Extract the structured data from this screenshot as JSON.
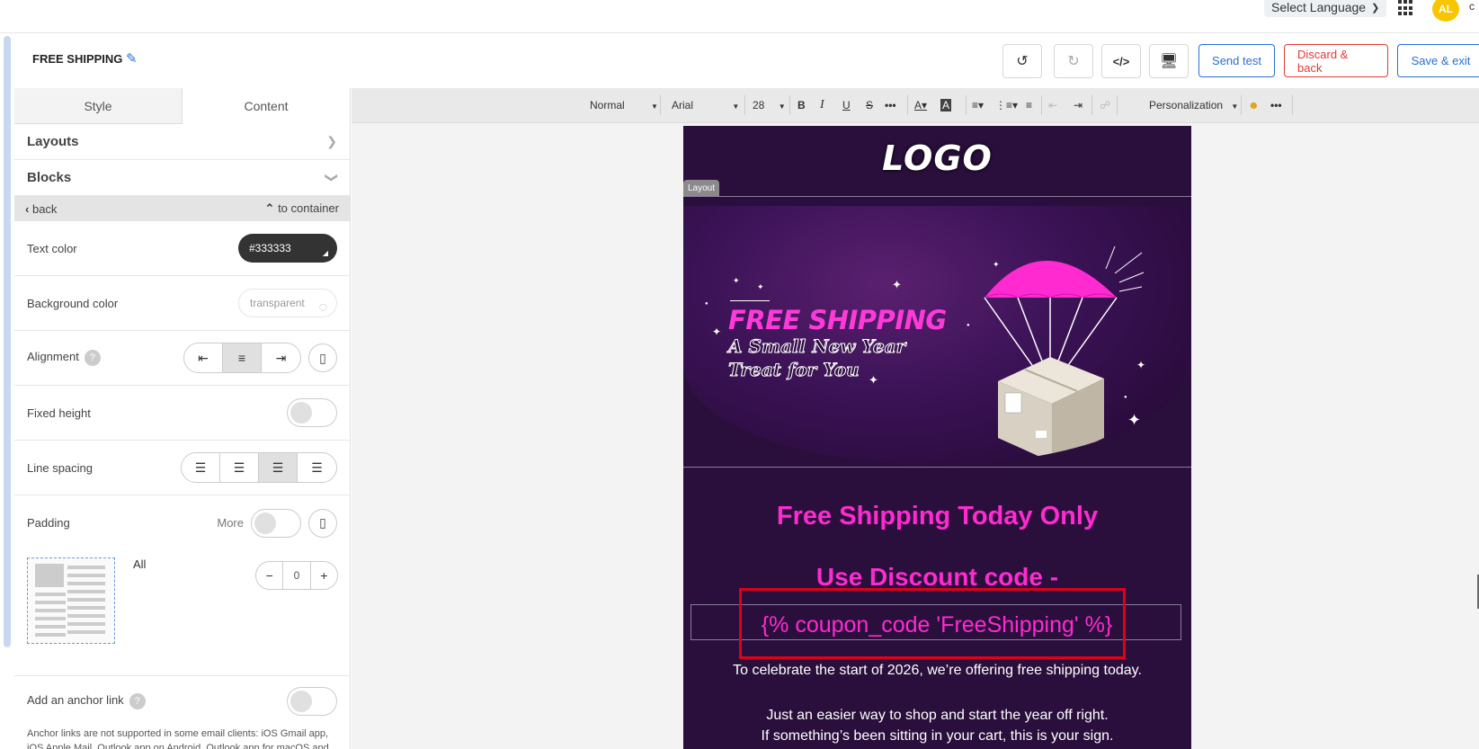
{
  "topbar": {
    "language_label": "Select Language",
    "avatar_initials": "AL",
    "avatar_extra": "c"
  },
  "header": {
    "title": "FREE SHIPPING",
    "send_test": "Send test",
    "discard": "Discard & back",
    "save": "Save & exit"
  },
  "panel": {
    "tabs": [
      "Style",
      "Content"
    ],
    "layouts_label": "Layouts",
    "blocks_label": "Blocks",
    "back_label": "back",
    "to_container_label": "to container",
    "text_color_label": "Text color",
    "text_color_value": "#333333",
    "bg_color_label": "Background color",
    "bg_color_value": "transparent",
    "alignment_label": "Alignment",
    "fixed_height_label": "Fixed height",
    "line_spacing_label": "Line spacing",
    "padding_label": "Padding",
    "padding_more": "More",
    "padding_all": "All",
    "padding_value": "0",
    "anchor_label": "Add an anchor link",
    "anchor_note": "Anchor links are not supported in some email clients: iOS Gmail app, iOS Apple Mail, Outlook app on Android, Outlook app for macOS and AMP Emails."
  },
  "toolbar": {
    "paragraph": "Normal",
    "font": "Arial",
    "size": "28",
    "personalization": "Personalization"
  },
  "email": {
    "logo": "LOGO",
    "layout_tag": "Layout",
    "banner_title": "FREE SHIPPING",
    "banner_sub_1": "A Small New Year",
    "banner_sub_2": "Treat for You",
    "headline": "Free Shipping Today Only",
    "discount_heading": "Use Discount code -",
    "coupon": "{% coupon_code 'FreeShipping' %}",
    "line1": "To celebrate the start of 2026, we’re offering free shipping today.",
    "line2": "Just an easier way to shop and start the year off right.",
    "line3": "If something’s been sitting in your cart, this is your sign."
  },
  "colors": {
    "accent_blue": "#2a6fd6",
    "danger_red": "#e53935",
    "email_bg": "#2a0f3c",
    "headline_pink": "#ff2ad0",
    "highlight_red": "#e0001b"
  }
}
